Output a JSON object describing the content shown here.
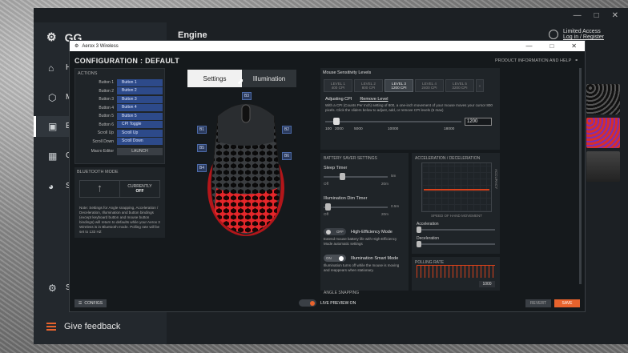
{
  "gg": {
    "logo": "GG",
    "header": "Engine",
    "user_line1": "Limited Access",
    "user_line2": "Log in / Register",
    "nav": [
      {
        "label": "H",
        "icon": "home-icon"
      },
      {
        "label": "M",
        "icon": "hexagon-icon"
      },
      {
        "label": "E",
        "icon": "chip-icon"
      },
      {
        "label": "G",
        "icon": "gift-icon"
      },
      {
        "label": "S",
        "icon": "sonar-icon"
      },
      {
        "label": "S",
        "icon": "gear-icon"
      }
    ],
    "feedback": "Give feedback"
  },
  "engine": {
    "window_title": "Aerox 3 Wireless",
    "config_title": "CONFIGURATION : DEFAULT",
    "product_info": "PRODUCT INFORMATION AND HELP",
    "actions_head": "ACTIONS",
    "actions": [
      {
        "label": "Button 1",
        "value": "Button 1"
      },
      {
        "label": "Button 2",
        "value": "Button 2"
      },
      {
        "label": "Button 3",
        "value": "Button 3"
      },
      {
        "label": "Button 4",
        "value": "Button 4"
      },
      {
        "label": "Button 5",
        "value": "Button 5"
      },
      {
        "label": "Button 6",
        "value": "CPI Toggle"
      },
      {
        "label": "Scroll Up",
        "value": "Scroll Up"
      },
      {
        "label": "Scroll Down",
        "value": "Scroll Down"
      }
    ],
    "macro_label": "Macro Editor",
    "macro_value": "LAUNCH",
    "bt_head": "BLUETOOTH MODE",
    "bt_currently": "CURRENTLY",
    "bt_state": "OFF",
    "bt_note": "Note: Settings for Angle snapping, Acceleration / Deceleration, Illumination and button bindings (except keyboard button and mouse button bindings) will return to defaults while your Aerox 3 Wireless is in Bluetooth mode. Polling rate will be set to 133 HZ",
    "tab_settings": "Settings",
    "tab_illumination": "Illumination",
    "mouse_buttons": [
      "B1",
      "B2",
      "B3",
      "B4",
      "B5",
      "B6"
    ],
    "sens_head": "Mouse Sensitivity Levels",
    "levels": [
      {
        "name": "LEVEL 1",
        "cpi": "400 CPI"
      },
      {
        "name": "LEVEL 2",
        "cpi": "800 CPI"
      },
      {
        "name": "LEVEL 3",
        "cpi": "1200 CPI"
      },
      {
        "name": "LEVEL 4",
        "cpi": "2400 CPI"
      },
      {
        "name": "LEVEL 5",
        "cpi": "3200 CPI"
      }
    ],
    "add_level": "+",
    "adjusting": "Adjusting CPI",
    "remove_level": "Remove Level",
    "cpi_note": "With a CPI (Counts Per Inch) setting of 800, a one-inch movement of your mouse moves your cursor 800 pixels. Click the sliders below to adjust, add, or remove CPI levels (5 max)",
    "cpi_ticks": [
      "100",
      "2000",
      "5000",
      "10000",
      "18000"
    ],
    "cpi_value": "1200",
    "battery_head": "BATTERY SAVER SETTINGS",
    "sleep_timer": "Sleep Timer",
    "sleep_off": "Off",
    "sleep_max": "20m",
    "sleep_val": "5m",
    "dim_timer": "Illumination Dim Timer",
    "dim_off": "Off",
    "dim_max": "20m",
    "dim_val": "0.5m",
    "hi_eff_state": "OFF",
    "hi_eff_label": "High-Efficiency Mode",
    "hi_eff_note": "Extend mouse battery life with High-Efficiency Mode automatic settings",
    "smart_state": "ON",
    "smart_label": "Illumination Smart Mode",
    "smart_note": "Illumination turns off while the mouse is moving and reappears when stationary.",
    "accel_head": "ACCELERATION / DECELERATION",
    "accel_xlabel": "SPEED OF HAND MOVEMENT",
    "accel_ylabel": "ACCURACY",
    "accel_label": "Acceleration",
    "decel_label": "Deceleration",
    "poll_head": "POLLING RATE",
    "poll_value": "1000",
    "angle_head": "ANGLE SNAPPING",
    "configs_btn": "CONFIGS",
    "live_preview": "LIVE PREVIEW ON",
    "revert": "REVERT",
    "save": "SAVE"
  }
}
